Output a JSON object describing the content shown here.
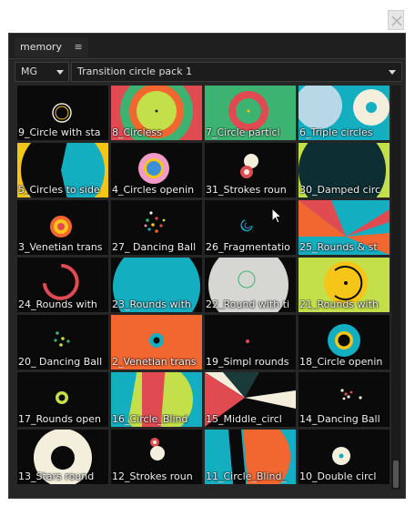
{
  "panel": {
    "tab_label": "memory",
    "menu_icon": "hamburger-icon",
    "category": "MG",
    "pack": "Transition circle pack 1"
  },
  "tiles": [
    {
      "label": "9_Circle with sta",
      "icon": "ring-outline"
    },
    {
      "label": "8_Circless",
      "icon": "concentric-rings"
    },
    {
      "label": "7_Circle particl",
      "icon": "ring-on-green"
    },
    {
      "label": "6_Triple circles",
      "icon": "triple-circles"
    },
    {
      "label": "5_Circles to side",
      "icon": "split-circle"
    },
    {
      "label": "4_Circles openin",
      "icon": "pink-blue-circle"
    },
    {
      "label": "31_Strokes roun",
      "icon": "strokes-cluster"
    },
    {
      "label": "30_Damped circ",
      "icon": "damped-circle"
    },
    {
      "label": "3_Venetian trans",
      "icon": "orange-target"
    },
    {
      "label": "27_ Dancing Ball",
      "icon": "dancing-dots"
    },
    {
      "label": "26_Fragmentatio",
      "icon": "fragment-swirl"
    },
    {
      "label": "25_Rounds & st",
      "icon": "wedges"
    },
    {
      "label": "24_Rounds with",
      "icon": "red-arc"
    },
    {
      "label": "23_Rounds with",
      "icon": "teal-disc"
    },
    {
      "label": "22_Round with ti",
      "icon": "grey-disc"
    },
    {
      "label": "21_Rounds with",
      "icon": "lime-yellow-disc"
    },
    {
      "label": "20_ Dancing Ball",
      "icon": "green-dots"
    },
    {
      "label": "2_Venetian trans",
      "icon": "orange-teal-target"
    },
    {
      "label": "19_Simpl rounds",
      "icon": "tiny-dot"
    },
    {
      "label": "18_Circle openin",
      "icon": "teal-yellow-ring"
    },
    {
      "label": "17_Rounds open",
      "icon": "lime-ring"
    },
    {
      "label": "16_Circle_Blind",
      "icon": "blind-circle"
    },
    {
      "label": "15_Middle_circl",
      "icon": "middle-wedges"
    },
    {
      "label": "14_Dancing Ball",
      "icon": "scattered-dots"
    },
    {
      "label": "13_Stars round",
      "icon": "cream-ring"
    },
    {
      "label": "12_Strokes roun",
      "icon": "strokes-cluster-2"
    },
    {
      "label": "11_Circle_Blind_",
      "icon": "teal-orange-blind"
    },
    {
      "label": "10_Double circl",
      "icon": "double-circle"
    }
  ],
  "colors": {
    "panel_bg": "#262626",
    "tile_bg": "#0a0a0a",
    "red": "#e04b52",
    "teal": "#14aec1",
    "orange": "#f26630",
    "lime": "#c3e04a",
    "green": "#3cb371",
    "yellow": "#f5c518",
    "cream": "#f3efdc"
  }
}
